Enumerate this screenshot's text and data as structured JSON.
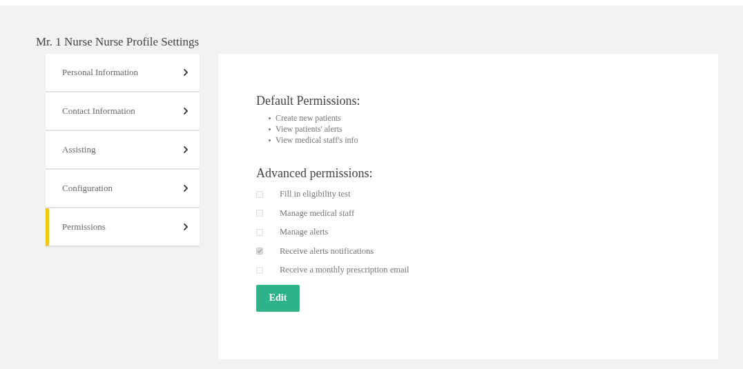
{
  "page_title": "Mr. 1 Nurse Nurse Profile Settings",
  "sidebar": {
    "items": [
      {
        "label": "Personal Information",
        "selected": false
      },
      {
        "label": "Contact Information",
        "selected": false
      },
      {
        "label": "Assisting",
        "selected": false
      },
      {
        "label": "Configuration",
        "selected": false
      },
      {
        "label": "Permissions",
        "selected": true
      }
    ]
  },
  "default_permissions": {
    "heading": "Default Permissions:",
    "items": [
      "Create new patients",
      "View patients' alerts",
      "View medical staff's info"
    ]
  },
  "advanced_permissions": {
    "heading": "Advanced permissions:",
    "items": [
      {
        "label": "Fill in eligibility test",
        "checked": false
      },
      {
        "label": "Manage medical staff",
        "checked": false
      },
      {
        "label": "Manage alerts",
        "checked": false
      },
      {
        "label": "Receive alerts notifications",
        "checked": true
      },
      {
        "label": "Receive a monthly prescription email",
        "checked": false
      }
    ]
  },
  "edit_button": "Edit"
}
